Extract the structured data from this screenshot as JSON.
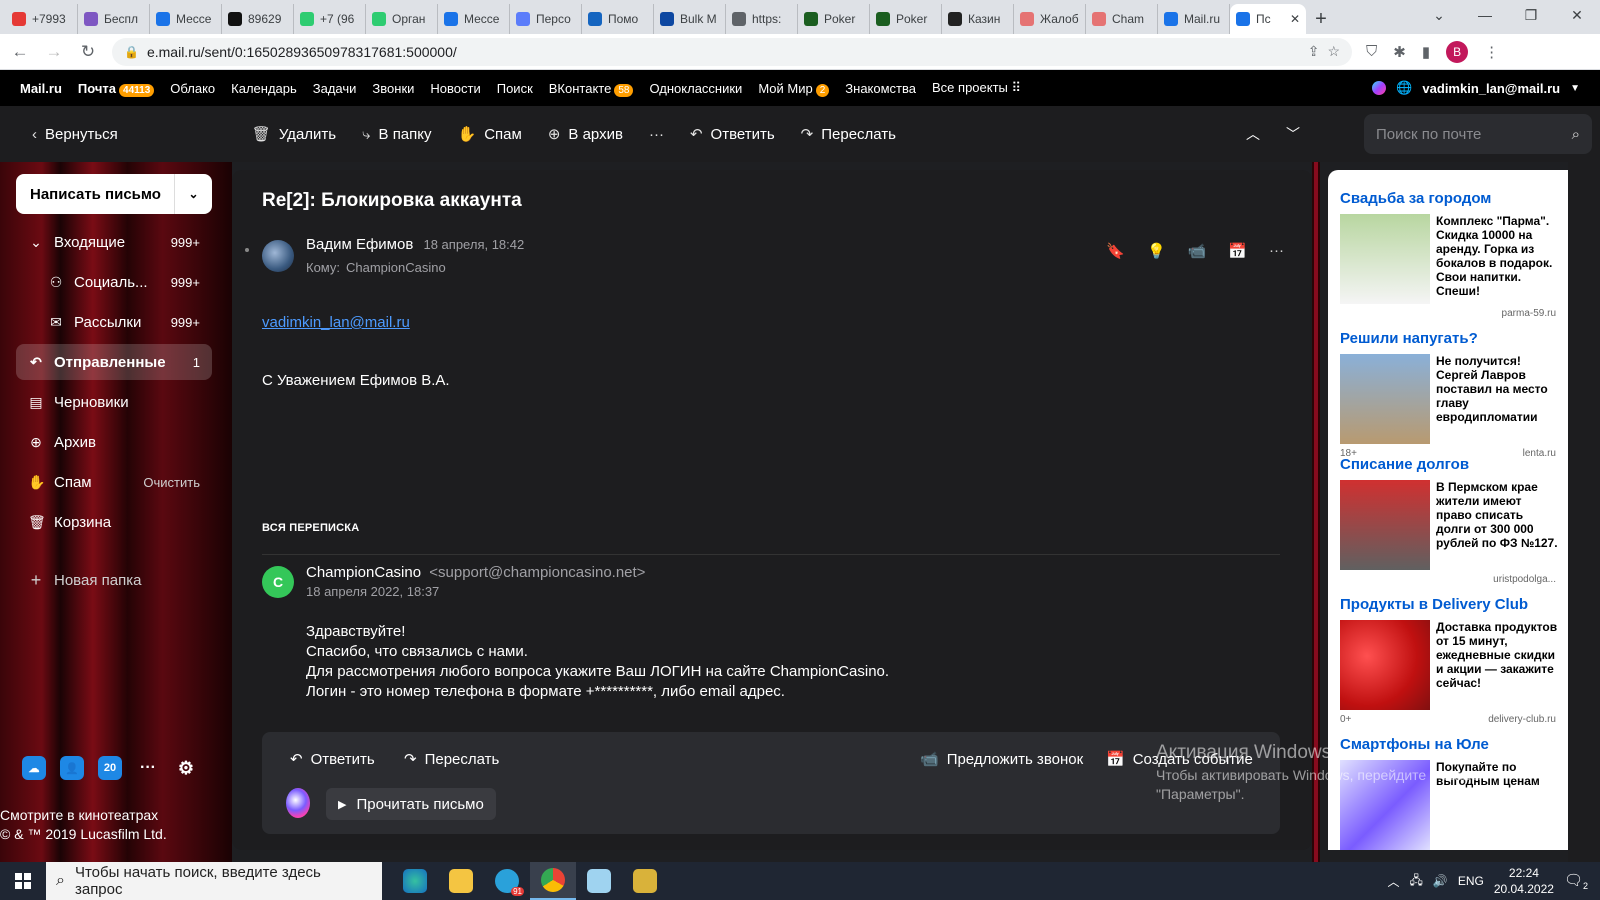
{
  "browser": {
    "tabs": [
      {
        "label": "+7993",
        "color": "#e53935"
      },
      {
        "label": "Беспл",
        "color": "#7e57c2"
      },
      {
        "label": "Мессе",
        "color": "#1a73e8"
      },
      {
        "label": "89629",
        "color": "#111111"
      },
      {
        "label": "+7 (96",
        "color": "#2ecc71"
      },
      {
        "label": "Орган",
        "color": "#2ecc71"
      },
      {
        "label": "Мессе",
        "color": "#1a73e8"
      },
      {
        "label": "Персо",
        "color": "#5b7cfa"
      },
      {
        "label": "Помо",
        "color": "#1565c0"
      },
      {
        "label": "Bulk M",
        "color": "#0d47a1"
      },
      {
        "label": "https:",
        "color": "#5f6368"
      },
      {
        "label": "Poker",
        "color": "#1b5e20"
      },
      {
        "label": "Poker",
        "color": "#1b5e20"
      },
      {
        "label": "Казин",
        "color": "#222222"
      },
      {
        "label": "Жалоб",
        "color": "#e57373"
      },
      {
        "label": "Cham",
        "color": "#e57373"
      },
      {
        "label": "Mail.ru",
        "color": "#1a73e8"
      }
    ],
    "active_tab": {
      "label": "Пс",
      "color": "#1a73e8"
    },
    "url": "e.mail.ru/sent/0:16502893650978317681:500000/",
    "profile_letter": "B"
  },
  "portal": {
    "items": [
      "Mail.ru",
      "Почта",
      "Облако",
      "Календарь",
      "Задачи",
      "Звонки",
      "Новости",
      "Поиск",
      "ВКонтакте",
      "Одноклассники",
      "Мой Мир",
      "Знакомства",
      "Все проекты"
    ],
    "mail_badge": "44113",
    "vk_badge": "58",
    "mymir_badge": "2",
    "user": "vadimkin_lan@mail.ru"
  },
  "toolbar": {
    "back": "Вернуться",
    "delete": "Удалить",
    "to_folder": "В папку",
    "spam": "Спам",
    "archive": "В архив",
    "reply": "Ответить",
    "forward": "Переслать",
    "search_placeholder": "Поиск по почте"
  },
  "sidebar": {
    "compose": "Написать письмо",
    "inbox": {
      "label": "Входящие",
      "count": "999+"
    },
    "social": {
      "label": "Социаль...",
      "count": "999+"
    },
    "newsletters": {
      "label": "Рассылки",
      "count": "999+"
    },
    "sent": {
      "label": "Отправленные",
      "count": "1"
    },
    "drafts": {
      "label": "Черновики"
    },
    "archive": {
      "label": "Архив"
    },
    "spam": {
      "label": "Спам",
      "action": "Очистить"
    },
    "trash": {
      "label": "Корзина"
    },
    "new_folder": "Новая папка",
    "calendar_day": "20",
    "promo_line1": "Смотрите в кинотеатрах",
    "promo_line2": "© & ™ 2019 Lucasfilm Ltd."
  },
  "message": {
    "subject": "Re[2]: Блокировка аккаунта",
    "from_name": "Вадим Ефимов",
    "date": "18 апреля, 18:42",
    "to_label": "Кому:",
    "to": "ChampionCasino",
    "link": "vadimkin_lan@mail.ru",
    "signature": "С Уважением Ефимов В.А.",
    "thread_label": "ВСЯ ПЕРЕПИСКА"
  },
  "quoted": {
    "avatar_letter": "C",
    "from_name": "ChampionCasino",
    "from_addr": "<support@championcasino.net>",
    "date": "18 апреля 2022, 18:37",
    "lines": [
      "Здравствуйте!",
      "Спасибо, что связались с нами.",
      "Для рассмотрения любого вопроса укажите Ваш ЛОГИН на сайте ChampionCasino.",
      "Логин - это номер телефона в формате +**********, либо email адрес."
    ]
  },
  "actions": {
    "reply": "Ответить",
    "forward": "Переслать",
    "call": "Предложить звонок",
    "event": "Создать событие",
    "read": "Прочитать письмо"
  },
  "watermark": {
    "line1": "Активация Windows",
    "line2": "Чтобы активировать Windows, перейдите в раздел",
    "line3": "\"Параметры\"."
  },
  "ads": [
    {
      "title": "Свадьба за городом",
      "text": "Комплекс \"Парма\". Скидка 10000 на аренду. Горка из бокалов в подарок. Свои напитки. Спеши!",
      "source": "parma-59.ru",
      "age": "",
      "color1": "#b8d6a0",
      "color2": "#f5f5f5"
    },
    {
      "title": "Решили напугать?",
      "text": "Не получится! Сергей Лавров поставил на место главу евродипломатии",
      "source": "lenta.ru",
      "age": "18+",
      "color1": "#8ab0d8",
      "color2": "#b89a70"
    },
    {
      "title": "Списание долгов",
      "text": "В Пермском крае жители имеют право списать долги от 300 000 рублей по ФЗ №127.",
      "source": "uristpodolga...",
      "age": "",
      "color1": "#d03030",
      "color2": "#606060"
    },
    {
      "title": "Продукты в Delivery Club",
      "text": "Доставка продуктов от 15 минут, ежедневные скидки и акции — закажите сейчас!",
      "source": "delivery-club.ru",
      "age": "0+",
      "color1": "#e02020",
      "color2": "#c01010"
    },
    {
      "title": "Смартфоны на Юле",
      "text": "Покупайте по выгодным ценам",
      "source": "",
      "age": "",
      "color1": "#7a5cff",
      "color2": "#e0e0ff"
    }
  ],
  "taskbar": {
    "search_placeholder": "Чтобы начать поиск, введите здесь запрос",
    "lang": "ENG",
    "time": "22:24",
    "date": "20.04.2022",
    "notif_count": "2",
    "telegram_badge": "91"
  }
}
